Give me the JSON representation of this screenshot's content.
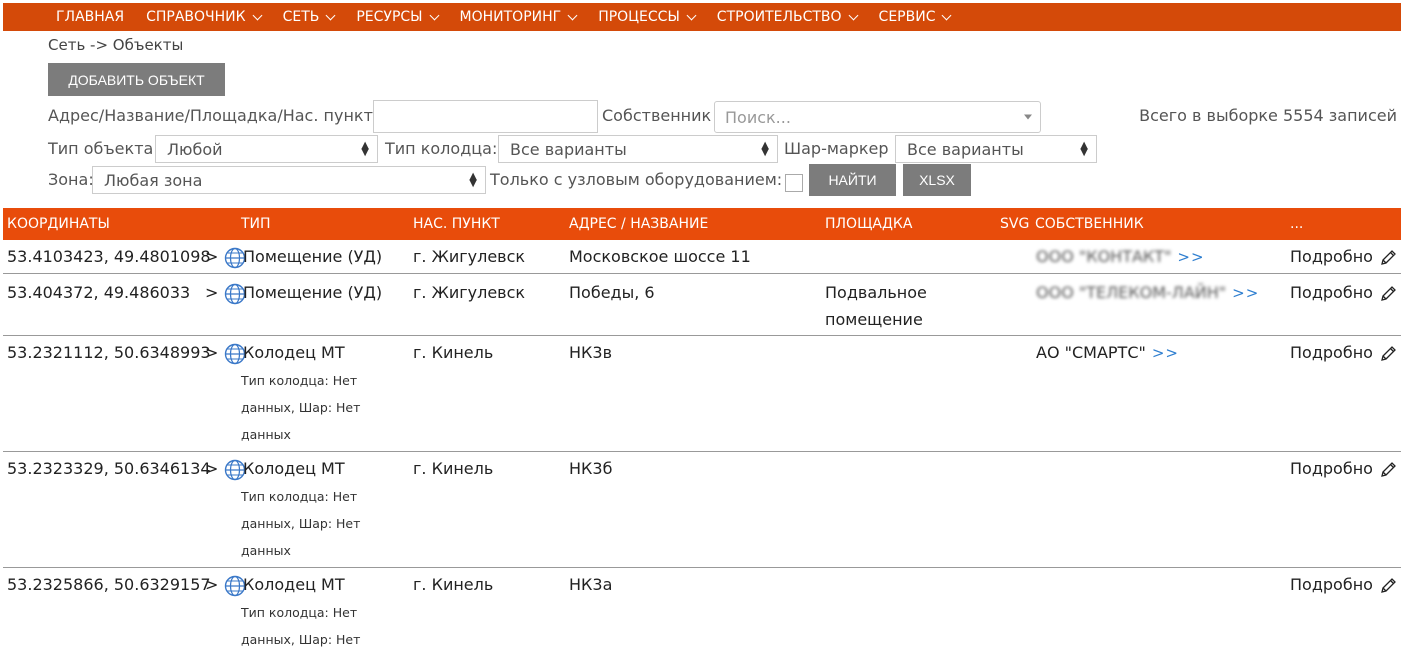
{
  "nav": [
    {
      "label": "ГЛАВНАЯ",
      "dropdown": false
    },
    {
      "label": "СПРАВОЧНИК",
      "dropdown": true
    },
    {
      "label": "СЕТЬ",
      "dropdown": true
    },
    {
      "label": "РЕСУРСЫ",
      "dropdown": true
    },
    {
      "label": "МОНИТОРИНГ",
      "dropdown": true
    },
    {
      "label": "ПРОЦЕССЫ",
      "dropdown": true
    },
    {
      "label": "СТРОИТЕЛЬСТВО",
      "dropdown": true
    },
    {
      "label": "СЕРВИС",
      "dropdown": true
    }
  ],
  "breadcrumb": "Сеть -> Объекты",
  "add_button": "ДОБАВИТЬ ОБЪЕКТ",
  "filters": {
    "address_label": "Адрес/Название/Площадка/Нас. пункт",
    "address_value": "",
    "owner_label": "Собственник",
    "owner_placeholder": "Поиск...",
    "total": "Всего в выборке 5554 записей",
    "object_type_label": "Тип объекта",
    "object_type_value": "Любой",
    "well_type_label": "Тип колодца:",
    "well_type_value": "Все варианты",
    "marker_label": "Шар-маркер",
    "marker_value": "Все варианты",
    "zone_label": "Зона:",
    "zone_value": "Любая зона",
    "node_only_label": "Только с узловым оборудованием:",
    "find_button": "НАЙТИ",
    "xlsx_button": "XLSX"
  },
  "table": {
    "headers": [
      "КООРДИНАТЫ",
      "ТИП",
      "НАС. ПУНКТ",
      "АДРЕС / НАЗВАНИЕ",
      "ПЛОЩАДКА",
      "SVG",
      "СОБСТВЕННИК",
      "..."
    ],
    "rows": [
      {
        "coords": "53.4103423, 49.4801098",
        "arrow": ">",
        "type": "Помещение (УД)",
        "type_detail": "",
        "city": "г. Жигулевск",
        "address": "Московское шоссе 11",
        "site": "",
        "owner": "ООО \"КОНТАКТ\"",
        "owner_blurred": true,
        "owner_link": ">>",
        "details": "Подробно"
      },
      {
        "coords": "53.404372, 49.486033",
        "arrow": ">",
        "type": "Помещение (УД)",
        "type_detail": "",
        "city": "г. Жигулевск",
        "address": "Победы, 6",
        "site": "Подвальное помещение",
        "owner": "ООО \"ТЕЛЕКОМ-ЛАЙН\"",
        "owner_blurred": true,
        "owner_link": ">>",
        "details": "Подробно"
      },
      {
        "coords": "53.2321112, 50.6348993",
        "arrow": ">",
        "type": "Колодец МТ",
        "type_detail": "Тип колодца: Нет данных, Шар: Нет данных",
        "city": "г. Кинель",
        "address": "НК3в",
        "site": "",
        "owner": "АО \"СМАРТС\"",
        "owner_blurred": false,
        "owner_link": ">>",
        "details": "Подробно"
      },
      {
        "coords": "53.2323329, 50.6346134",
        "arrow": ">",
        "type": "Колодец МТ",
        "type_detail": "Тип колодца: Нет данных, Шар: Нет данных",
        "city": "г. Кинель",
        "address": "НК3б",
        "site": "",
        "owner": "",
        "owner_blurred": false,
        "owner_link": "",
        "details": "Подробно"
      },
      {
        "coords": "53.2325866, 50.6329157",
        "arrow": ">",
        "type": "Колодец МТ",
        "type_detail": "Тип колодца: Нет данных, Шар: Нет данных",
        "city": "г. Кинель",
        "address": "НК3а",
        "site": "",
        "owner": "",
        "owner_blurred": false,
        "owner_link": "",
        "details": "Подробно"
      }
    ]
  },
  "colors": {
    "navbar": "#d44a09",
    "table_header": "#e84c0b",
    "button": "#7c7c7c",
    "link": "#2f7fd0"
  },
  "icons": {
    "globe": "globe-icon",
    "edit": "pencil-icon",
    "dropdown": "chevron-down-icon"
  }
}
